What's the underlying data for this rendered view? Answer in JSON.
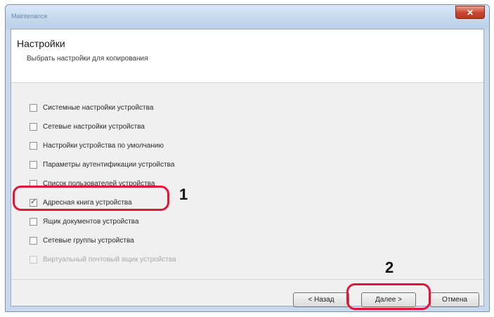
{
  "window": {
    "title": "Maintenance",
    "close_label": "✕"
  },
  "header": {
    "title": "Настройки",
    "subtitle": "Выбрать настройки для копирования"
  },
  "options": [
    {
      "label": "Системные настройки устройства",
      "checked": false,
      "enabled": true
    },
    {
      "label": "Сетевые настройки устройства",
      "checked": false,
      "enabled": true
    },
    {
      "label": "Настройки устройства по умолчанию",
      "checked": false,
      "enabled": true
    },
    {
      "label": "Параметры аутентификации устройства",
      "checked": false,
      "enabled": true
    },
    {
      "label": "Список пользователей устройства",
      "checked": false,
      "enabled": true
    },
    {
      "label": "Адресная книга устройства",
      "checked": true,
      "enabled": true
    },
    {
      "label": "Ящик документов устройства",
      "checked": false,
      "enabled": true
    },
    {
      "label": "Сетевые группы устройства",
      "checked": false,
      "enabled": true
    },
    {
      "label": "Виртуальный почтовый ящик устройства",
      "checked": false,
      "enabled": false
    }
  ],
  "check_mark": "✓",
  "callouts": {
    "one": "1",
    "two": "2"
  },
  "highlight_color": "#e2143a",
  "footer": {
    "back_label": "< Назад",
    "next_label": "Далее >",
    "cancel_label": "Отмена"
  }
}
